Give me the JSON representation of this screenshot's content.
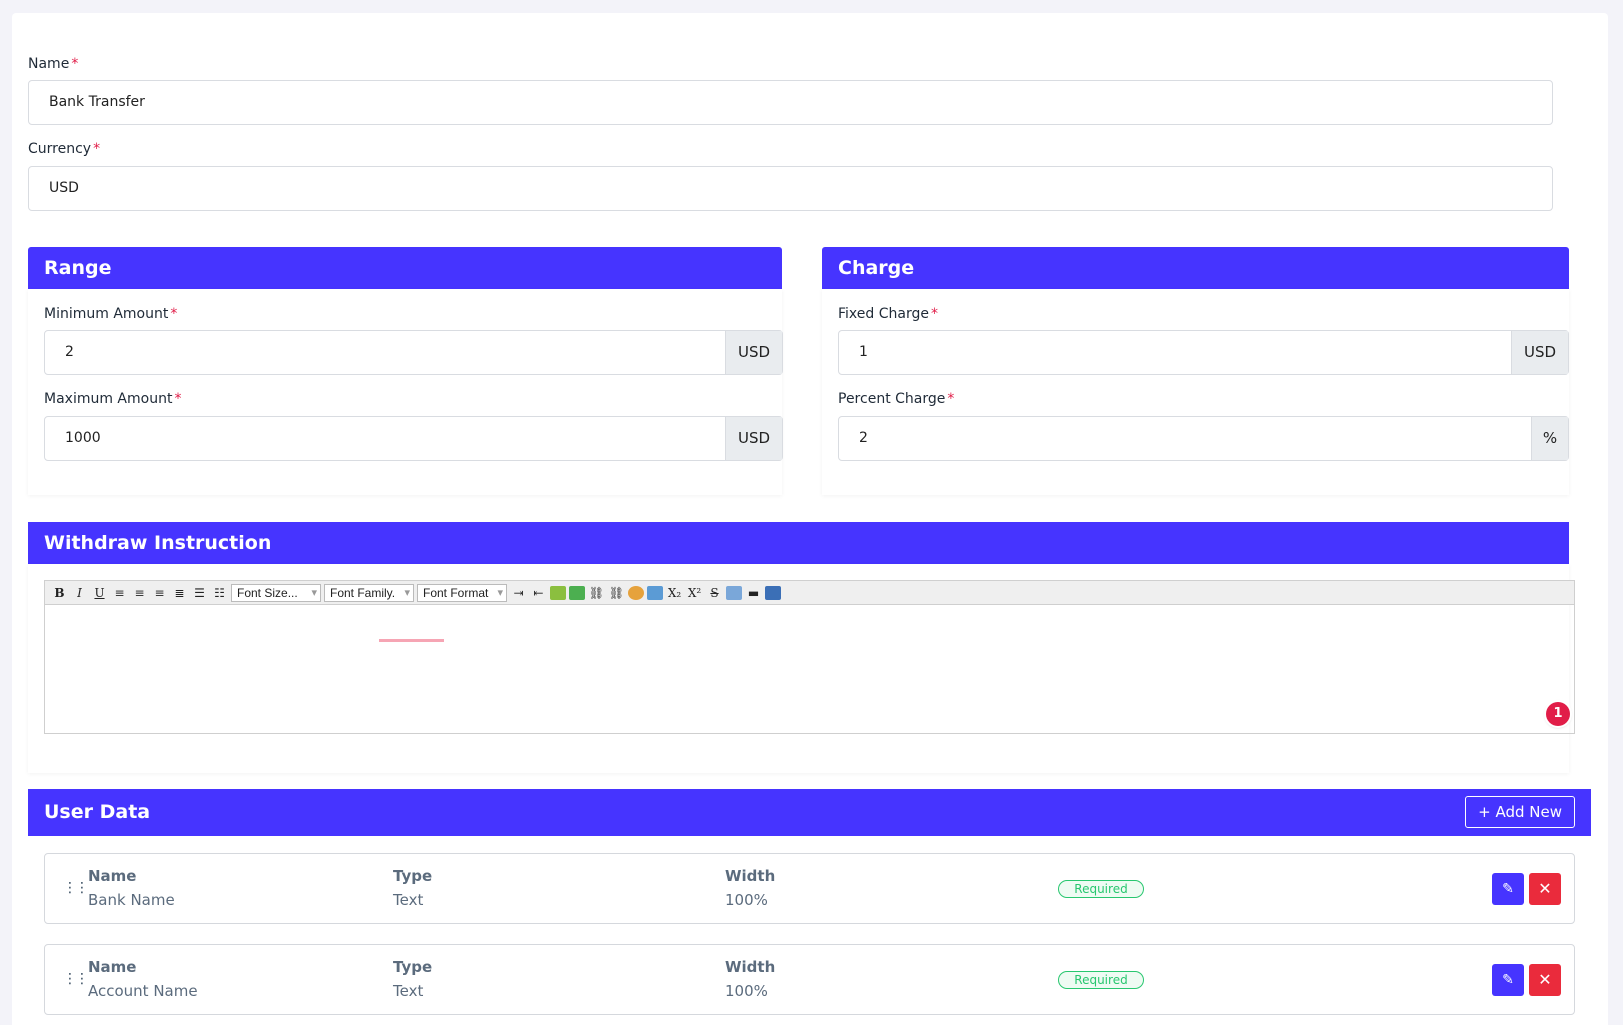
{
  "form": {
    "name_label": "Name",
    "name_value": "Bank Transfer",
    "currency_label": "Currency",
    "currency_value": "USD",
    "required_mark": "*"
  },
  "range": {
    "title": "Range",
    "min_label": "Minimum Amount",
    "min_value": "2",
    "min_unit": "USD",
    "max_label": "Maximum Amount",
    "max_value": "1000",
    "max_unit": "USD"
  },
  "charge": {
    "title": "Charge",
    "fixed_label": "Fixed Charge",
    "fixed_value": "1",
    "fixed_unit": "USD",
    "percent_label": "Percent Charge",
    "percent_value": "2",
    "percent_unit": "%"
  },
  "instruction": {
    "title": "Withdraw Instruction",
    "toolbar": {
      "bold": "B",
      "italic": "I",
      "underline": "U",
      "font_size": "Font Size...",
      "font_family": "Font Family.",
      "font_format": "Font Format",
      "subscript": "X₂",
      "superscript": "X²",
      "strike": "S"
    },
    "badge_count": "1"
  },
  "user_data": {
    "title": "User Data",
    "add_label": "Add New",
    "add_icon": "plus-icon",
    "rows": [
      {
        "name_h": "Name",
        "name_v": "Bank Name",
        "type_h": "Type",
        "type_v": "Text",
        "width_h": "Width",
        "width_v": "100%",
        "status": "Required"
      },
      {
        "name_h": "Name",
        "name_v": "Account Name",
        "type_h": "Type",
        "type_v": "Text",
        "width_h": "Width",
        "width_v": "100%",
        "status": "Required"
      }
    ]
  },
  "colors": {
    "primary": "#4634ff",
    "danger": "#ea2b3c",
    "success": "#28c76f"
  }
}
